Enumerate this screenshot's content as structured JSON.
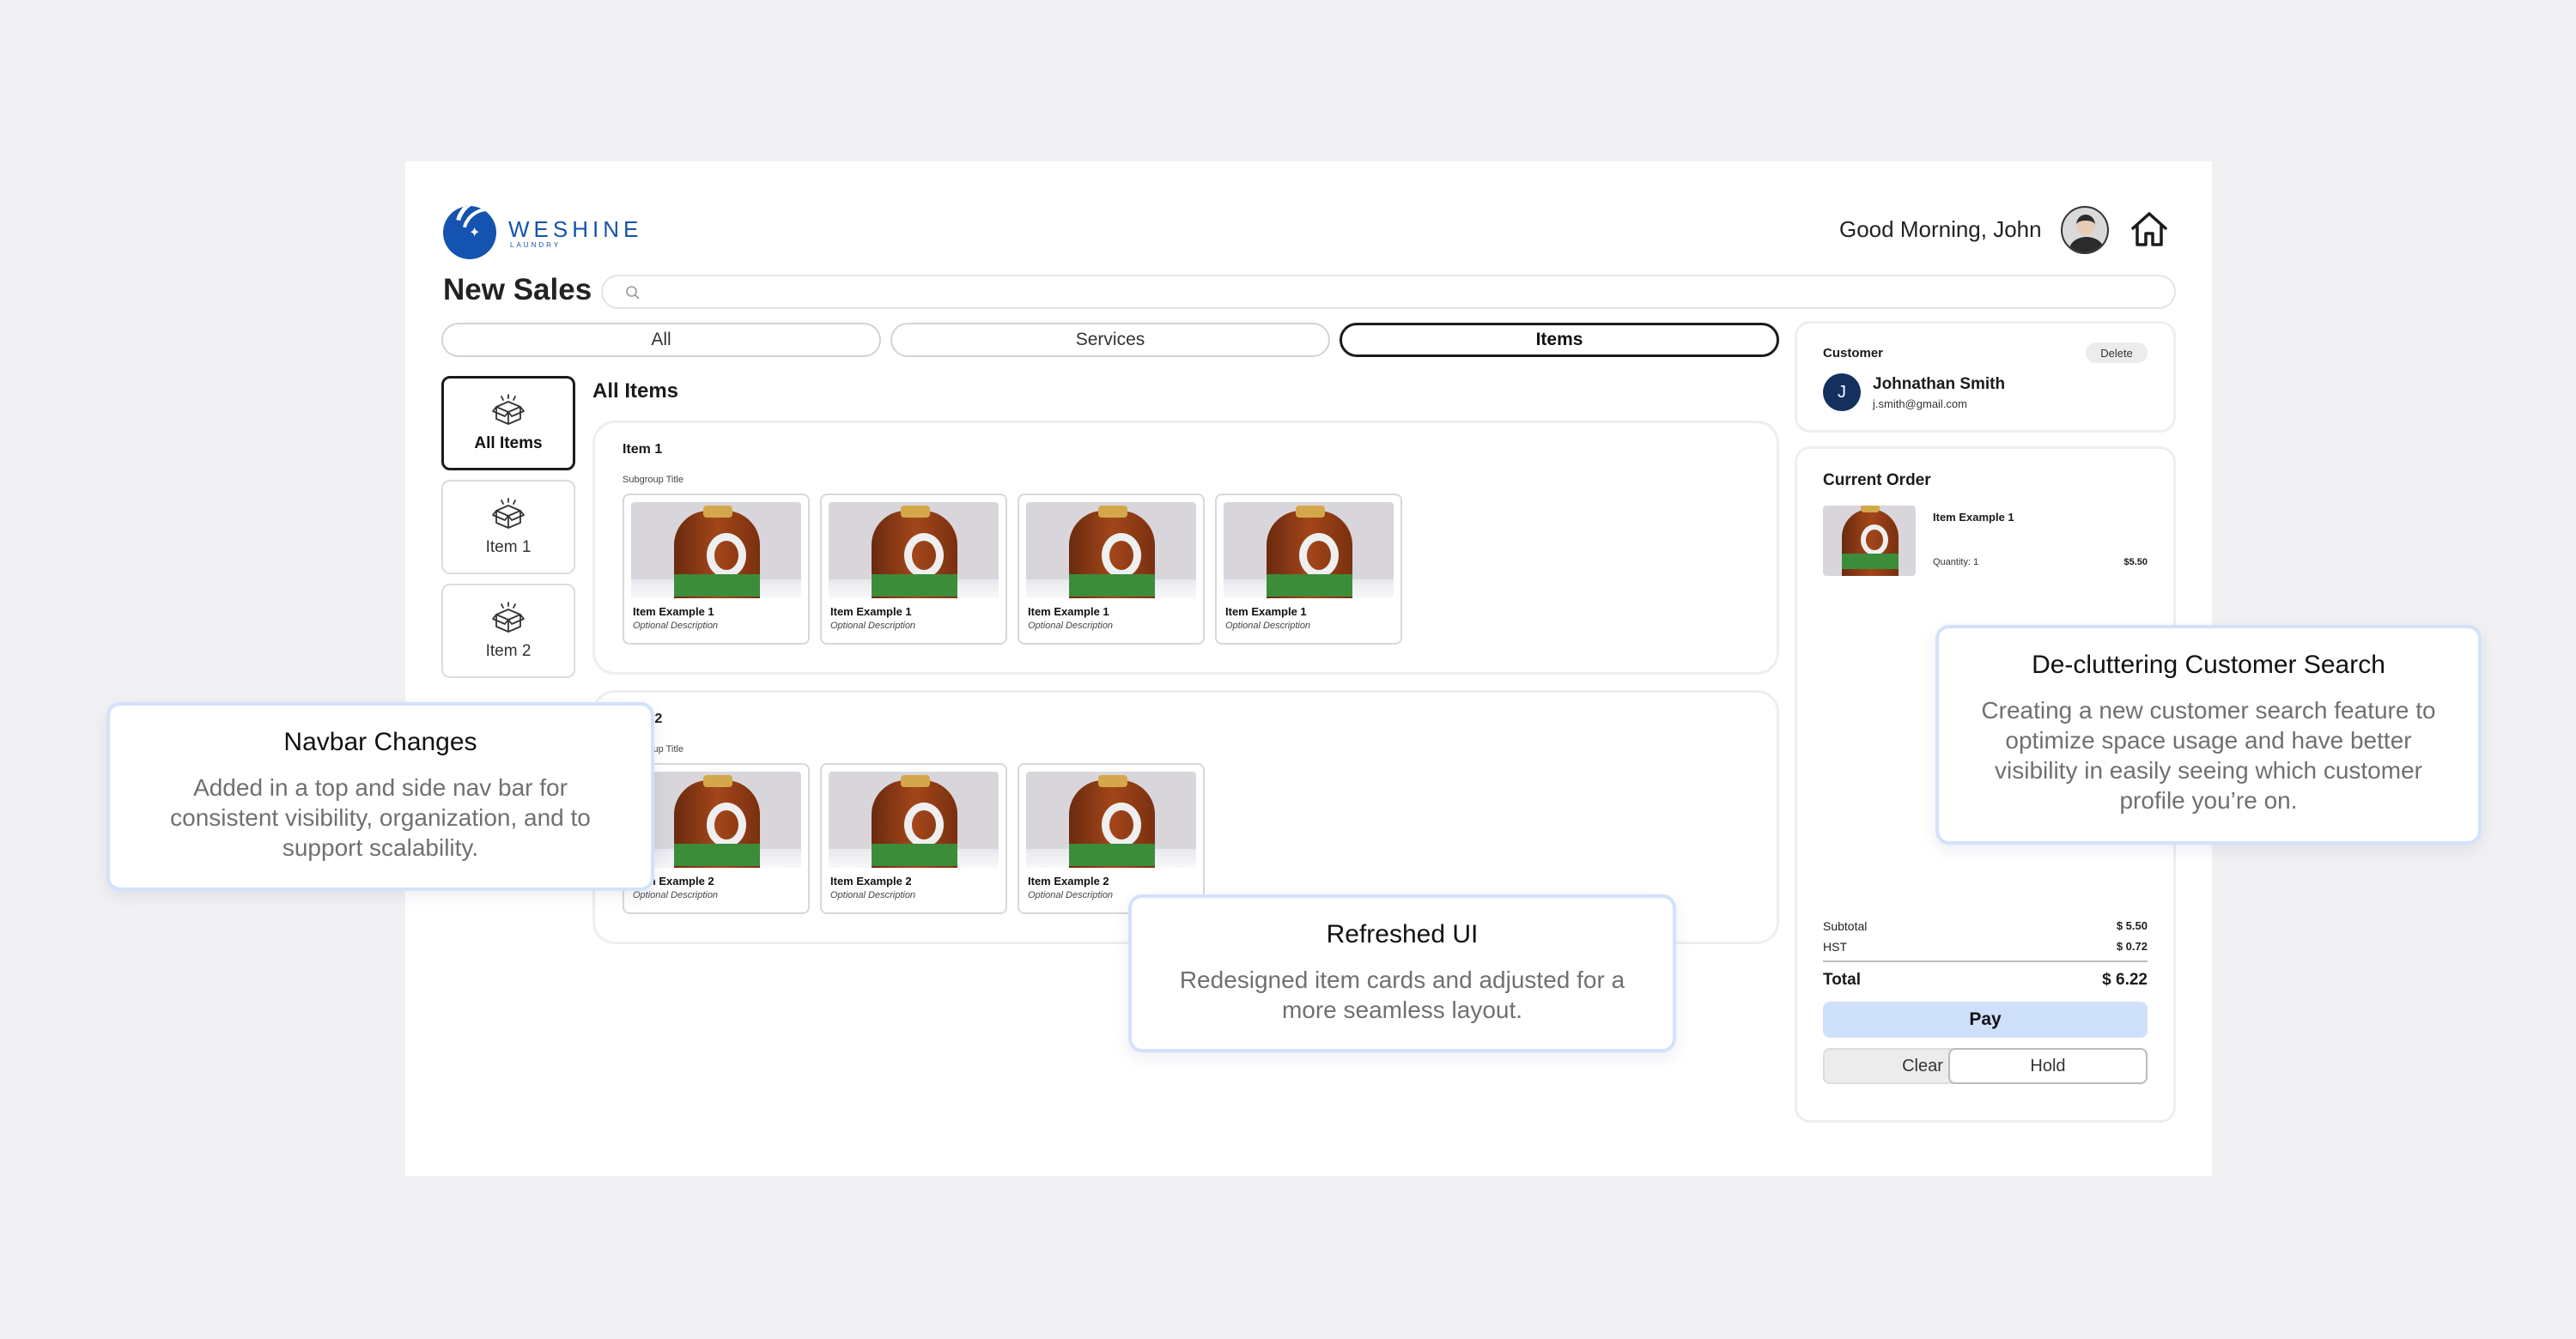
{
  "brand": {
    "name": "WESHINE",
    "sub": "LAUNDRY",
    "accent": "#1553b0"
  },
  "header": {
    "greeting": "Good Morning, John"
  },
  "page": {
    "title": "New Sales",
    "search_placeholder": ""
  },
  "tabs": [
    {
      "label": "All",
      "active": false
    },
    {
      "label": "Services",
      "active": false
    },
    {
      "label": "Items",
      "active": true
    }
  ],
  "sidebar": {
    "items": [
      {
        "label": "All Items",
        "active": true
      },
      {
        "label": "Item 1",
        "active": false
      },
      {
        "label": "Item 2",
        "active": false
      }
    ]
  },
  "main": {
    "section_title": "All Items",
    "groups": [
      {
        "title": "Item 1",
        "subtitle": "Subgroup Title",
        "cards": [
          {
            "name": "Item Example 1",
            "desc": "Optional Description"
          },
          {
            "name": "Item Example 1",
            "desc": "Optional Description"
          },
          {
            "name": "Item Example 1",
            "desc": "Optional Description"
          },
          {
            "name": "Item Example 1",
            "desc": "Optional Description"
          }
        ]
      },
      {
        "title": "Item 2",
        "subtitle": "Subgroup Title",
        "cards": [
          {
            "name": "Item Example 2",
            "desc": "Optional Description"
          },
          {
            "name": "Item Example 2",
            "desc": "Optional Description"
          },
          {
            "name": "Item Example 2",
            "desc": "Optional Description"
          }
        ]
      }
    ]
  },
  "customer": {
    "label": "Customer",
    "delete_label": "Delete",
    "initial": "J",
    "name": "Johnathan Smith",
    "email": "j.smith@gmail.com"
  },
  "order": {
    "title": "Current Order",
    "item_name": "Item Example 1",
    "quantity": "Quantity: 1",
    "price": "$5.50",
    "subtotal_label": "Subtotal",
    "subtotal": "$ 5.50",
    "hst_label": "HST",
    "hst": "$ 0.72",
    "total_label": "Total",
    "total": "$ 6.22",
    "pay_label": "Pay",
    "clear_label": "Clear",
    "hold_label": "Hold"
  },
  "callouts": {
    "navbar": {
      "title": "Navbar Changes",
      "body": "Added in a top and side nav bar for consistent visibility, organization, and to support scalability."
    },
    "refreshed": {
      "title": "Refreshed UI",
      "body": "Redesigned item cards and adjusted for a more seamless layout."
    },
    "declutter": {
      "title": "De-cluttering Customer Search",
      "body": "Creating a new customer search feature to optimize space usage and have better visibility in easily seeing which customer profile you’re on."
    }
  }
}
